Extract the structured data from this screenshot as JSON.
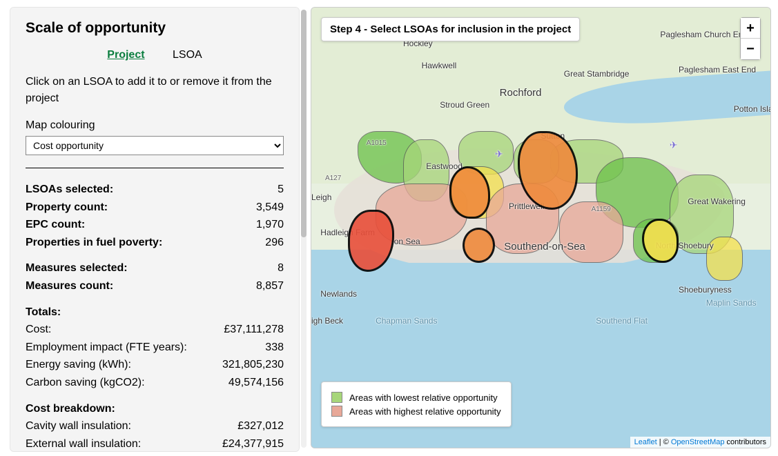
{
  "sidebar": {
    "title": "Scale of opportunity",
    "tabs": {
      "project": "Project",
      "lsoa": "LSOA"
    },
    "instructions": "Click on an LSOA to add it to or remove it from the project",
    "colouring_label": "Map colouring",
    "colouring_selected": "Cost opportunity",
    "stats": {
      "lsoas_selected": {
        "label": "LSOAs selected:",
        "value": "5"
      },
      "property_count": {
        "label": "Property count:",
        "value": "3,549"
      },
      "epc_count": {
        "label": "EPC count:",
        "value": "1,970"
      },
      "fuel_poverty": {
        "label": "Properties in fuel poverty:",
        "value": "296"
      },
      "measures_selected": {
        "label": "Measures selected:",
        "value": "8"
      },
      "measures_count": {
        "label": "Measures count:",
        "value": "8,857"
      }
    },
    "totals_header": "Totals:",
    "totals": {
      "cost": {
        "label": "Cost:",
        "value": "£37,111,278"
      },
      "employment": {
        "label": "Employment impact (FTE years):",
        "value": "338"
      },
      "energy": {
        "label": "Energy saving (kWh):",
        "value": "321,805,230"
      },
      "carbon": {
        "label": "Carbon saving (kgCO2):",
        "value": "49,574,156"
      }
    },
    "breakdown_header": "Cost breakdown:",
    "breakdown": {
      "cavity": {
        "label": "Cavity wall insulation:",
        "value": "£327,012"
      },
      "external": {
        "label": "External wall insulation:",
        "value": "£24,377,915"
      }
    }
  },
  "map": {
    "step_banner": "Step 4 - Select LSOAs for inclusion in the project",
    "zoom_in": "+",
    "zoom_out": "−",
    "legend": {
      "low": "Areas with lowest relative opportunity",
      "high": "Areas with highest relative opportunity"
    },
    "attribution": {
      "leaflet": "Leaflet",
      "sep": " | © ",
      "osm": "OpenStreetMap",
      "tail": " contributors"
    },
    "places": {
      "rochford": "Rochford",
      "hockley": "Hockley",
      "hawkwell": "Hawkwell",
      "stroud": "Stroud Green",
      "great_stambridge": "Great Stambridge",
      "paglesham_ce": "Paglesham Church End",
      "paglesham_ee": "Paglesham East End",
      "potton": "Potton Island",
      "sutton": "Sutton",
      "eastwood": "Eastwood",
      "great_wakering": "Great Wakering",
      "leigh": "Leigh",
      "leigh_on_sea": "on Sea",
      "southend": "Southend-on-Sea",
      "prittlewell": "Prittlewell",
      "hadleigh": "Hadleigh Farm",
      "newlands": "Newlands",
      "shoeburyness": "Shoeburyness",
      "north_shoebury": "North Shoebury",
      "chapman": "Chapman Sands",
      "southend_flat": "Southend Flat",
      "maplin": "Maplin Sands",
      "a127": "A127",
      "a1015": "A1015",
      "a1159": "A1159",
      "igh_beck": "igh Beck",
      "airport1": "✈",
      "airport2": "✈"
    }
  },
  "colors": {
    "low_swatch": "#a7d67a",
    "high_swatch": "#e8a898"
  }
}
